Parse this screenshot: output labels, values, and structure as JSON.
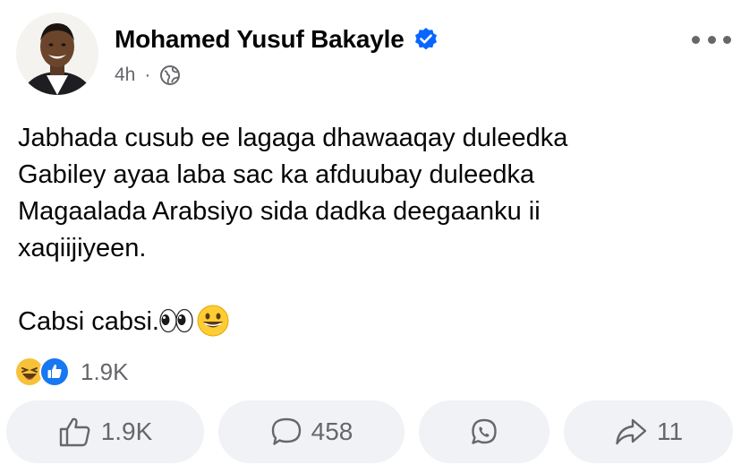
{
  "post": {
    "author": "Mohamed Yusuf Bakayle",
    "timestamp": "4h",
    "separator": "·",
    "paragraphs": [
      "Jabhada cusub ee lagaga dhawaaqay duleedka",
      "Gabiley ayaa laba sac ka afduubay duleedka",
      "Magaalada Arabsiyo sida dadka deegaanku ii",
      "xaqiijiyeen."
    ],
    "closing": "Cabsi cabsi."
  },
  "reactions": {
    "count": "1.9K",
    "icons": [
      "laughing-reaction-icon",
      "like-reaction-icon"
    ]
  },
  "actions": {
    "like": "1.9K",
    "comment": "458",
    "whatsapp": "",
    "share": "11"
  },
  "colors": {
    "muted": "#65676b",
    "verified": "#0866ff",
    "pill": "#f0f2f5",
    "text": "#050505"
  }
}
